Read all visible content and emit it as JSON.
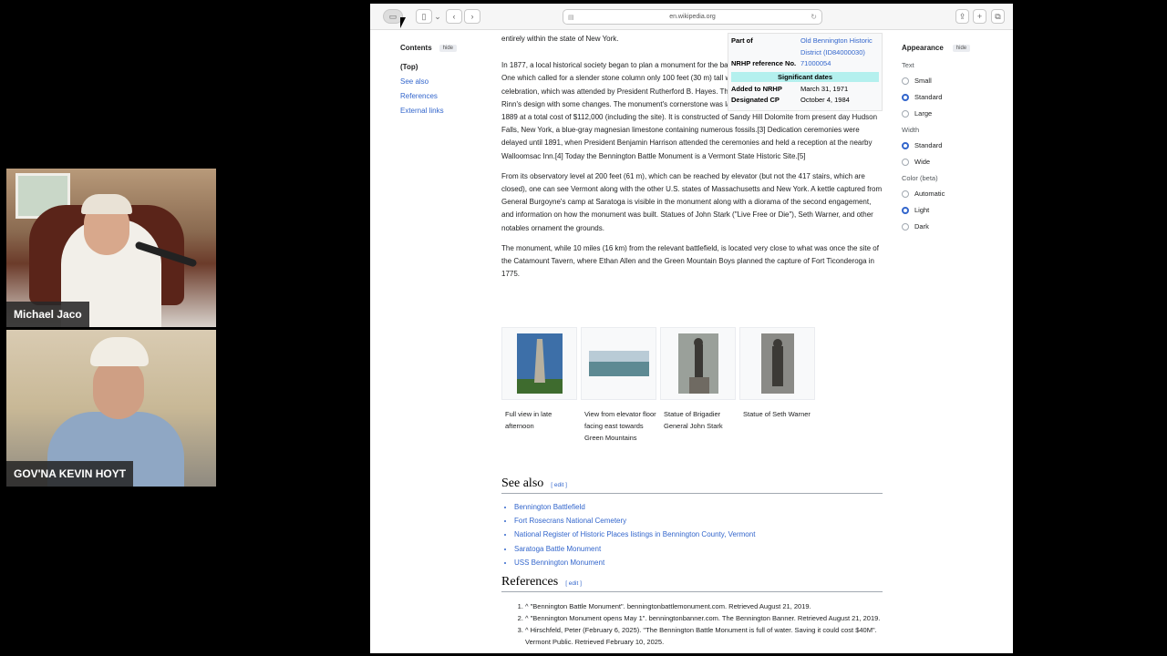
{
  "participants": [
    {
      "name": "Michael Jaco"
    },
    {
      "name": "GOV'NA KEVIN HOYT"
    }
  ],
  "browser": {
    "url": "en.wikipedia.org"
  },
  "toc": {
    "title": "Contents",
    "hide": "hide",
    "items": [
      "(Top)",
      "See also",
      "References",
      "External links"
    ]
  },
  "appearance": {
    "title": "Appearance",
    "hide": "hide",
    "text_label": "Text",
    "text_options": [
      "Small",
      "Standard",
      "Large"
    ],
    "text_selected": "Standard",
    "width_label": "Width",
    "width_options": [
      "Standard",
      "Wide"
    ],
    "width_selected": "Standard",
    "color_label": "Color (beta)",
    "color_options": [
      "Automatic",
      "Light",
      "Dark"
    ],
    "color_selected": "Light"
  },
  "infobox": {
    "part_of_label": "Part of",
    "part_of_value": "Old Bennington Historic District (ID84000030)",
    "nrhp_label": "NRHP reference No.",
    "nrhp_value": "71000054",
    "significant_dates": "Significant dates",
    "added_label": "Added to NRHP",
    "added_value": "March 31, 1971",
    "designated_label": "Designated CP",
    "designated_value": "October 4, 1984"
  },
  "article": {
    "p0": "entirely within the state of New York.",
    "p1": "In 1877, a local historical society began to plan a monument for the battle's centenary, and considered many designs. One which called for a slender stone column only 100 feet (30 m) tall was showcased during the battle's centennial celebration, which was attended by President Rutherford B. Hayes. The committee eventually accepted J. Phillip Rinn's design with some changes. The monument's cornerstone was laid in 1887, and it was completed in November 1889 at a total cost of $112,000 (including the site). It is constructed of Sandy Hill Dolomite from present day Hudson Falls, New York, a blue-gray magnesian limestone containing numerous fossils.[3] Dedication ceremonies were delayed until 1891, when President Benjamin Harrison attended the ceremonies and held a reception at the nearby Walloomsac Inn.[4] Today the Bennington Battle Monument is a Vermont State Historic Site.[5]",
    "p2": "From its observatory level at 200 feet (61 m), which can be reached by elevator (but not the 417 stairs, which are closed), one can see Vermont along with the other U.S. states of Massachusetts and New York. A kettle captured from General Burgoyne's camp at Saratoga is visible in the monument along with a diorama of the second engagement, and information on how the monument was built. Statues of John Stark (\"Live Free or Die\"), Seth Warner, and other notables ornament the grounds.",
    "p3": "The monument, while 10 miles (16 km) from the relevant battlefield, is located very close to what was once the site of the Catamount Tavern, where Ethan Allen and the Green Mountain Boys planned the capture of Fort Ticonderoga in 1775."
  },
  "gallery": [
    {
      "caption": "Full view in late afternoon"
    },
    {
      "caption": "View from elevator floor facing east towards Green Mountains"
    },
    {
      "caption": "Statue of Brigadier General John Stark"
    },
    {
      "caption": "Statue of Seth Warner"
    }
  ],
  "see_also": {
    "title": "See also",
    "edit": "[ edit ]",
    "items": [
      "Bennington Battlefield",
      "Fort Rosecrans National Cemetery",
      "National Register of Historic Places listings in Bennington County, Vermont",
      "Saratoga Battle Monument",
      "USS Bennington Monument"
    ]
  },
  "references": {
    "title": "References",
    "edit": "[ edit ]",
    "items": [
      "^ \"Bennington Battle Monument\". benningtonbattlemonument.com. Retrieved August 21, 2019.",
      "^ \"Bennington Monument opens May 1\". benningtonbanner.com. The Bennington Banner. Retrieved August 21, 2019.",
      "^ Hirschfeld, Peter (February 6, 2025). \"The Bennington Battle Monument is full of water. Saving it could cost $40M\". Vermont Public. Retrieved February 10, 2025."
    ]
  }
}
